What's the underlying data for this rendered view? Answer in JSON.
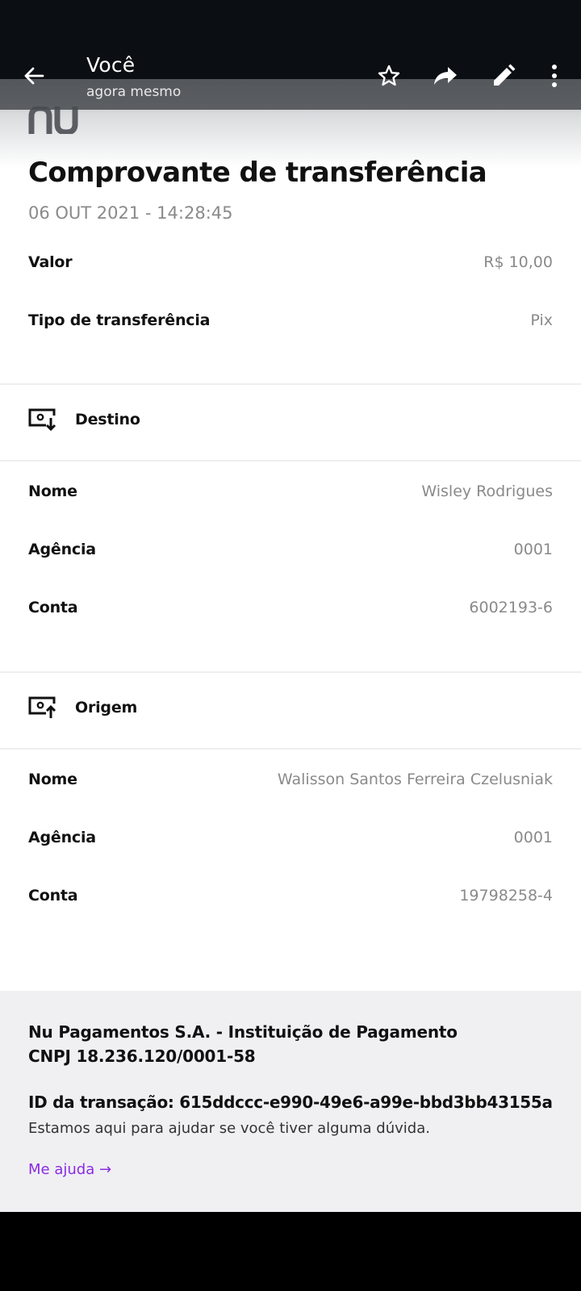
{
  "app_bar": {
    "title": "Você",
    "subtitle": "agora mesmo",
    "icons": [
      "back-arrow-icon",
      "star-outline-icon",
      "share-forward-icon",
      "edit-pencil-icon",
      "more-vertical-icon"
    ]
  },
  "receipt": {
    "logo_text": "nu",
    "title": "Comprovante de transferência",
    "date": "06 OUT 2021 - 14:28:45",
    "summary": [
      {
        "label": "Valor",
        "value": "R$ 10,00"
      },
      {
        "label": "Tipo de transferência",
        "value": "Pix"
      }
    ],
    "destination": {
      "heading": "Destino",
      "icon": "bank-receive-icon",
      "rows": [
        {
          "label": "Nome",
          "value": "Wisley Rodrigues"
        },
        {
          "label": "Agência",
          "value": "0001"
        },
        {
          "label": "Conta",
          "value": "6002193-6"
        }
      ]
    },
    "origin": {
      "heading": "Origem",
      "icon": "bank-send-icon",
      "rows": [
        {
          "label": "Nome",
          "value": "Walisson Santos Ferreira Czelusniak"
        },
        {
          "label": "Agência",
          "value": "0001"
        },
        {
          "label": "Conta",
          "value": "19798258-4"
        }
      ]
    }
  },
  "footer": {
    "company_line1": "Nu Pagamentos S.A. - Instituição de Pagamento",
    "company_line2": "CNPJ 18.236.120/0001-58",
    "transaction_id": "ID da transação: 615ddccc-e990-49e6-a99e-bbd3bb43155a",
    "help_text": "Estamos aqui para ajudar se você tiver alguma dúvida.",
    "help_link": "Me ajuda →"
  },
  "colors": {
    "link": "#8a2be2",
    "muted_text": "#8a8a8a",
    "footer_bg": "#f0f0f3",
    "app_bar_overlay": "#484c50"
  }
}
